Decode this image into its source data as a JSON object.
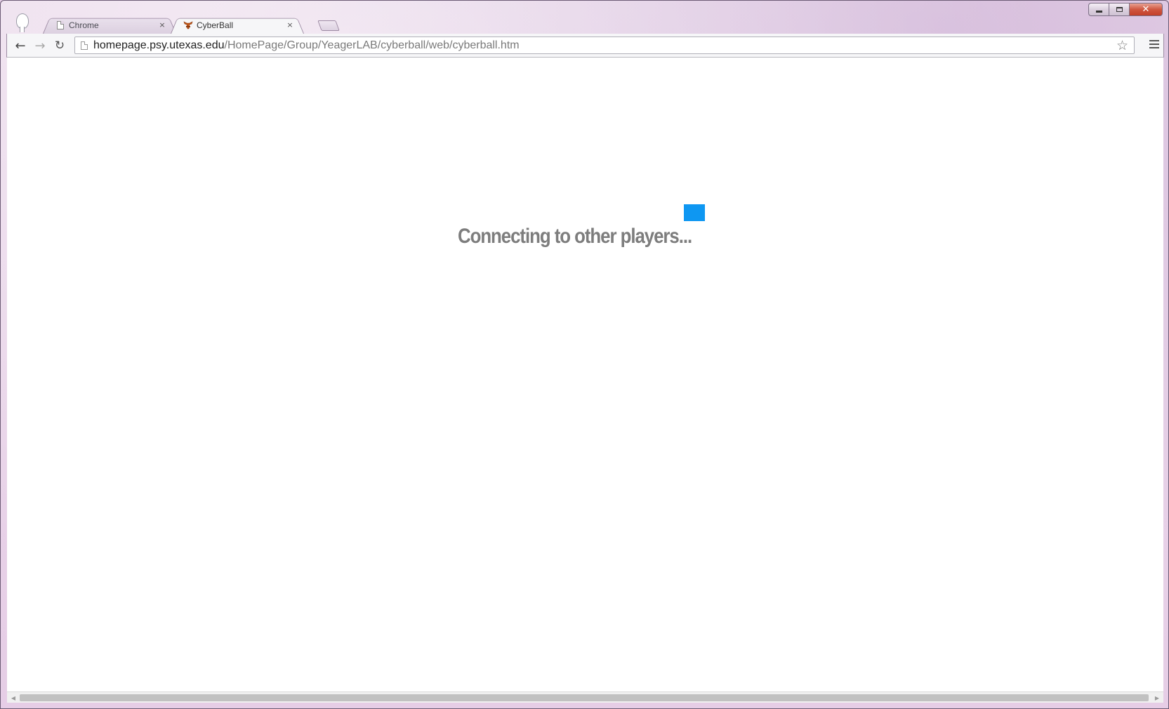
{
  "window": {
    "controls": {
      "minimize": "minimize",
      "maximize": "maximize",
      "close_label": "✕"
    }
  },
  "tabs": [
    {
      "title": "Chrome",
      "icon": "page-icon",
      "close_label": "×",
      "active": false
    },
    {
      "title": "CyberBall",
      "icon": "texas-longhorn-icon",
      "close_label": "×",
      "active": true
    }
  ],
  "toolbar": {
    "back_label": "←",
    "forward_label": "→",
    "reload_label": "↻",
    "url_host": "homepage.psy.utexas.edu",
    "url_path": "/HomePage/Group/YeagerLAB/cyberball/web/cyberball.htm",
    "star_label": "☆"
  },
  "page": {
    "status_text": "Connecting to other players...",
    "loading_color": "#0e97f2",
    "text_color": "#7d7d7d"
  },
  "scrollbar": {
    "left_arrow": "◀",
    "right_arrow": "▶"
  }
}
